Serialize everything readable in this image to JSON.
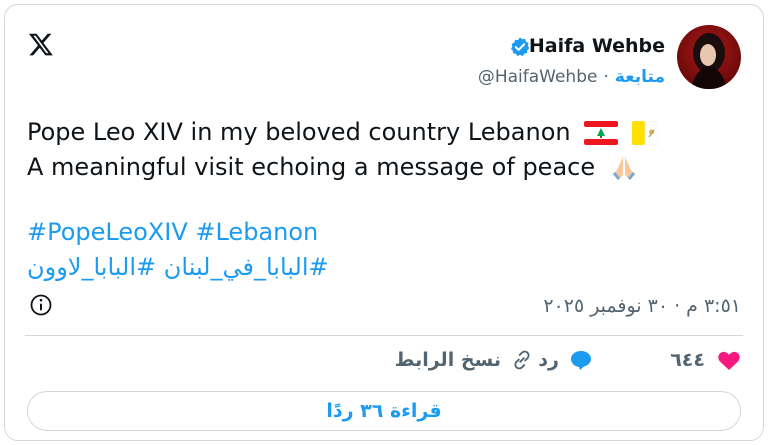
{
  "header": {
    "display_name": "Haifa Wehbe",
    "handle": "@HaifaWehbe",
    "separator": "·",
    "follow_label": "متابعة"
  },
  "tweet": {
    "line1": "Pope Leo XIV in my beloved country Lebanon",
    "line2": "A meaningful visit echoing a message of peace",
    "hashtags_line1": "#PopeLeoXIV #Lebanon",
    "hashtags_line2": "#البابا_في_لبنان #البابا_لاوون",
    "timestamp": "٣:٥١ م · ٣٠ نوفمبر ٢٠٢٥"
  },
  "actions": {
    "like_count": "٦٤٤",
    "reply_label": "رد",
    "copy_link_label": "نسخ الرابط",
    "read_replies_label": "قراءة ٣٦ ردًا"
  },
  "colors": {
    "accent": "#1d9bf0",
    "like": "#f91880",
    "text": "#0f1419",
    "muted": "#536471",
    "border": "#cfd9de"
  },
  "icons": {
    "logo": "x-logo-icon",
    "verified": "verified-badge-icon",
    "info": "info-icon",
    "like": "heart-icon",
    "reply": "reply-bubble-icon",
    "copy": "link-icon"
  }
}
